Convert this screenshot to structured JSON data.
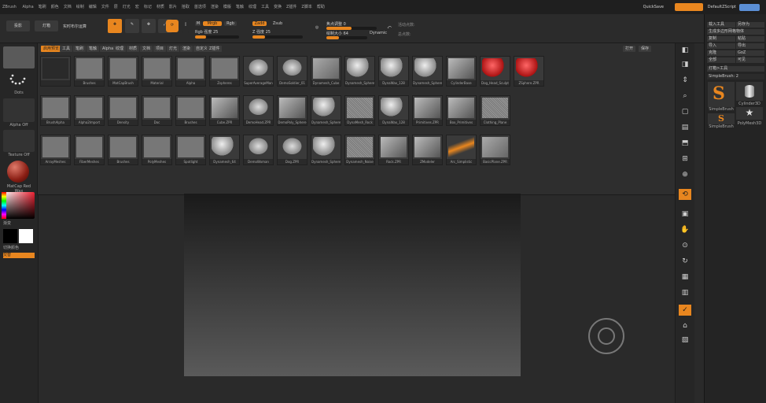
{
  "app": {
    "title": "ZBrush",
    "quicksave": "QuickSave",
    "script": "DefaultZScript"
  },
  "menu": [
    "Alpha",
    "笔刷",
    "颜色",
    "文档",
    "绘制",
    "编辑",
    "文件",
    "层",
    "灯光",
    "宏",
    "标记",
    "材质",
    "影片",
    "拾取",
    "首选项",
    "渲染",
    "模版",
    "笔触",
    "纹理",
    "工具",
    "变换",
    "Z插件",
    "Z脚本",
    "帮助"
  ],
  "toolbar": {
    "projection": "投影",
    "lightbox": "灯箱",
    "live_boolean": "实时布尔运算",
    "mrgb": "Mrgb",
    "rgb": "Rgb",
    "m": "M",
    "zadd": "Zadd",
    "zsub": "Zsub",
    "rgb_intensity": "Rgb 强度 25",
    "z_intensity": "Z 强度 25",
    "focal_shift": "焦点调整 0",
    "draw_size": "绘制大小 64",
    "dynamic": "Dynamic",
    "active_points": "活动点数:",
    "total_points": "总点数:"
  },
  "left_panel": {
    "dots_label": "Dots",
    "alpha_label": "Alpha Off",
    "texture_label": "Texture Off",
    "material_label": "MatCap Red Wax",
    "gradient_label": "渐变",
    "switch_label": "切换颜色",
    "alternate_label": "交替"
  },
  "popup": {
    "tabs": [
      "启用预览",
      "工具",
      "笔刷",
      "笔触",
      "Alpha",
      "纹理",
      "材质",
      "文档",
      "项目",
      "灯光",
      "渲染",
      "自定义",
      "Z插件"
    ],
    "buttons": [
      "打开",
      "保存"
    ],
    "items": [
      [
        "",
        "Brushes",
        "MatCapBrush",
        "Material",
        "Alpha",
        "Zspheres",
        "SuperAverageMan",
        "DemoSoldier_01",
        "Dynamesh_Cube",
        "Dynamesh_Sphere",
        "DynaWax_128",
        "Dynamesh_Sphere",
        "CylinderBase",
        "Dog_Head_Sculpt",
        "ZSphere.ZPR"
      ],
      [
        "BrushAlpha",
        "Alpha2Import",
        "Density",
        "Doc",
        "Brushes",
        "Cube.ZPR",
        "DemoHead.ZPR",
        "DemoPoly_Sphere",
        "Dynamesh_Sphere",
        "DynaMesh_Rock",
        "DynaWax_128",
        "Primitives.ZPR",
        "Box_Primitives",
        "Clothing_Plane"
      ],
      [
        "ArrayMeshes",
        "FiberMeshes",
        "Brushes",
        "PolyMeshes",
        "Spotlight",
        "Dynamesh_64",
        "DemoWoman",
        "Dog.ZPR",
        "Dynamesh_Sphere",
        "Dynamesh_Noise",
        "Rock.ZPR",
        "ZModeler",
        "Arc_Simplistic",
        "BasicPlane.ZPR"
      ]
    ]
  },
  "right_panel": {
    "load": "载入工具",
    "save_as": "另存为",
    "import": "导入",
    "export": "导出",
    "copy": "复制",
    "paste": "粘贴",
    "clone": "克隆",
    "make_polymesh": "生成多边形网格物体",
    "goz": "GoZ",
    "all": "全部",
    "visible": "可见",
    "lightbox_tool": "灯箱>工具",
    "current_tool": "SimpleBrush: 2",
    "tools": [
      "SimpleBrush",
      "Cylinder3D",
      "SimpleBrush",
      "PolyMesh3D"
    ]
  }
}
